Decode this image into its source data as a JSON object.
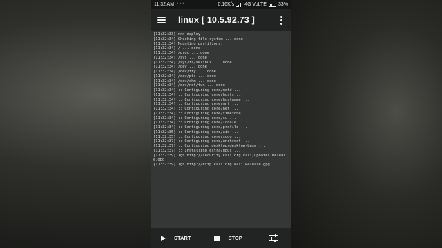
{
  "status_bar": {
    "time": "11:32 AM",
    "network_speed": "0.16K/s",
    "network_type": "4G VoLTE",
    "battery_percent": "33%",
    "battery_level": 0.33
  },
  "app_bar": {
    "title": "linux  [ 10.5.92.73 ]",
    "menu_icon": "hamburger-menu-icon",
    "overflow_icon": "more-vert-icon"
  },
  "console": {
    "lines": [
      "[11:32:33] >>> deploy",
      "[11:32:34] Checking file system ... done",
      "[11:32:34] Mounting partitions:",
      "[11:32:34] / ... done",
      "[11:32:34] /proc ... done",
      "[11:32:34] /sys ... done",
      "[11:32:34] /sys/fs/selinux ... done",
      "[11:32:34] /dev ... done",
      "[11:32:34] /dev/tty ... done",
      "[11:32:34] /dev/pts ... done",
      "[11:32:34] /dev/shm ... done",
      "[11:32:34] /dev/net/tun ... done",
      "[11:32:34] :: Configuring core/motd ...",
      "[11:32:34] :: Configuring core/hosts ...",
      "[11:32:34] :: Configuring core/hostname ...",
      "[11:32:34] :: Configuring core/mnt ...",
      "[11:32:34] :: Configuring core/net ...",
      "[11:32:34] :: Configuring core/timezone ...",
      "[11:32:34] :: Configuring core/su ...",
      "[11:32:34] :: Configuring core/locale ...",
      "[11:32:34] :: Configuring core/profile ...",
      "[11:32:35] :: Configuring core/aid ...",
      "[11:32:35] :: Configuring core/sudo ...",
      "[11:32:37] :: Configuring core/unchroot ...",
      "[11:32:37] :: Configuring desktop/desktop-base ...",
      "[11:32:37] :: Installing extra/dbus ...",
      "[11:32:39] Ign http://security.kali.org kali/updates Release.gpg",
      "[11:32:39] Ign http://http.kali.org kali Release.gpg"
    ]
  },
  "bottom_bar": {
    "start_label": "START",
    "stop_label": "STOP",
    "start_icon": "play-icon",
    "stop_icon": "stop-icon",
    "settings_icon": "tune-sliders-icon"
  }
}
